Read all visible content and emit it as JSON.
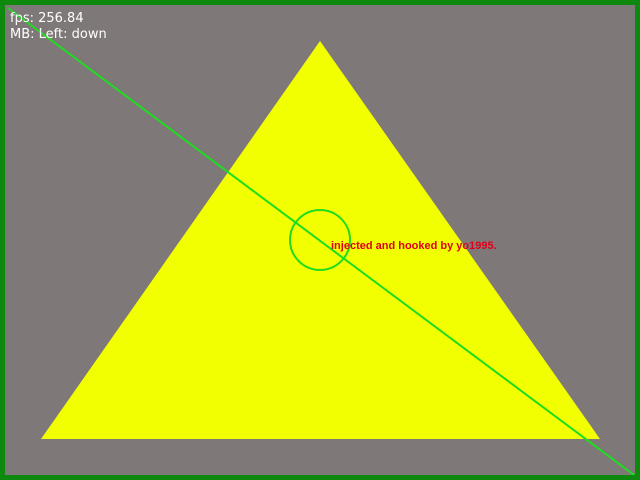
{
  "hud": {
    "fps_label": "fps: 256.84",
    "mouse_label": "MB: Left: down"
  },
  "overlay": {
    "text": "injected and hooked by yo1995."
  },
  "colors": {
    "background": "#7f7878",
    "border": "#0d8a0d",
    "triangle": "#f2ff00",
    "cursor_line": "#1fdc1f",
    "overlay_text": "#e0001a",
    "hud_text": "#ffffff"
  }
}
